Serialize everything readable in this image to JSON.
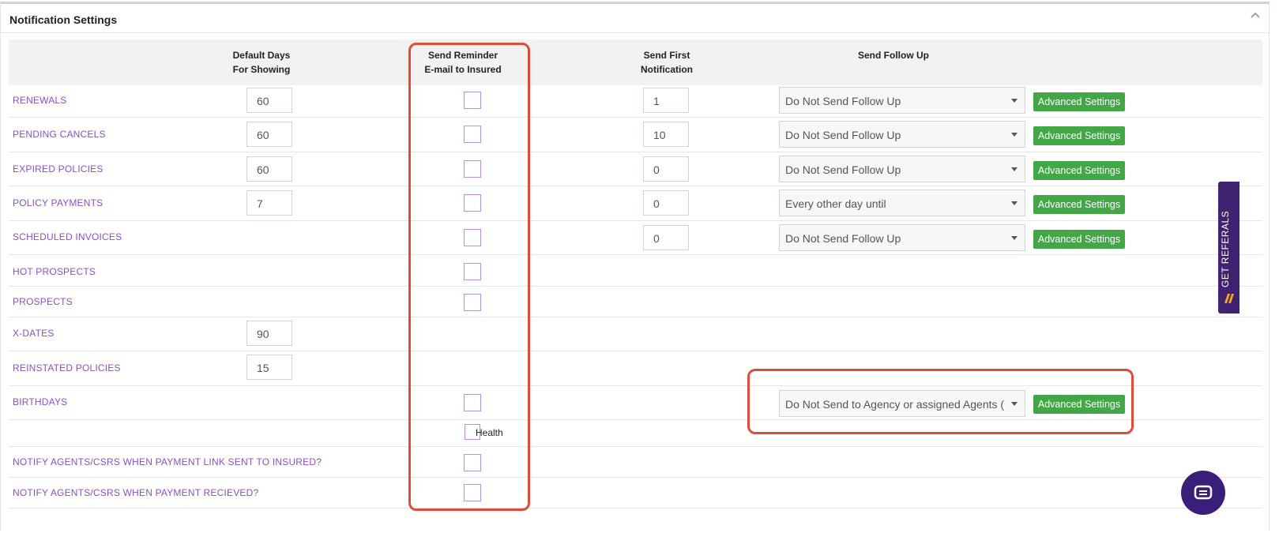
{
  "panel": {
    "title": "Notification Settings"
  },
  "table": {
    "headers": {
      "default_days": "Default Days\nFor Showing",
      "send_reminder": "Send Reminder\nE-mail to Insured",
      "send_first": "Send First\nNotification",
      "send_follow_up": "Send Follow Up"
    },
    "rows": [
      {
        "label": "RENEWALS",
        "default_days": "60",
        "first": "1",
        "follow_up": "Do Not Send Follow Up",
        "button": "Advanced Settings"
      },
      {
        "label": "PENDING CANCELS",
        "default_days": "60",
        "first": "10",
        "follow_up": "Do Not Send Follow Up",
        "button": "Advanced Settings"
      },
      {
        "label": "EXPIRED POLICIES",
        "default_days": "60",
        "first": "0",
        "follow_up": "Do Not Send Follow Up",
        "button": "Advanced Settings"
      },
      {
        "label": "POLICY PAYMENTS",
        "default_days": "7",
        "first": "0",
        "follow_up": "Every other day until",
        "button": "Advanced Settings"
      },
      {
        "label": "SCHEDULED INVOICES",
        "first": "0",
        "follow_up": "Do Not Send Follow Up",
        "button": "Advanced Settings"
      },
      {
        "label": "HOT PROSPECTS"
      },
      {
        "label": "PROSPECTS"
      },
      {
        "label": "X-DATES",
        "default_days": "90"
      },
      {
        "label": "REINSTATED POLICIES",
        "default_days": "15"
      },
      {
        "label": "BIRTHDAYS",
        "follow_up": "Do Not Send to Agency or assigned Agents (",
        "button": "Advanced Settings"
      },
      {
        "label": "",
        "checkbox_label": "Health"
      },
      {
        "label": "NOTIFY AGENTS/CSRS WHEN PAYMENT LINK SENT TO INSURED?"
      },
      {
        "label": "NOTIFY AGENTS/CSRS WHEN PAYMENT RECIEVED?"
      }
    ]
  },
  "side_tab": {
    "label": "GET REFERALS"
  },
  "colors": {
    "accent_purple": "#8a4fc8",
    "button_green": "#43a647",
    "highlight_red": "#e04b3a"
  }
}
